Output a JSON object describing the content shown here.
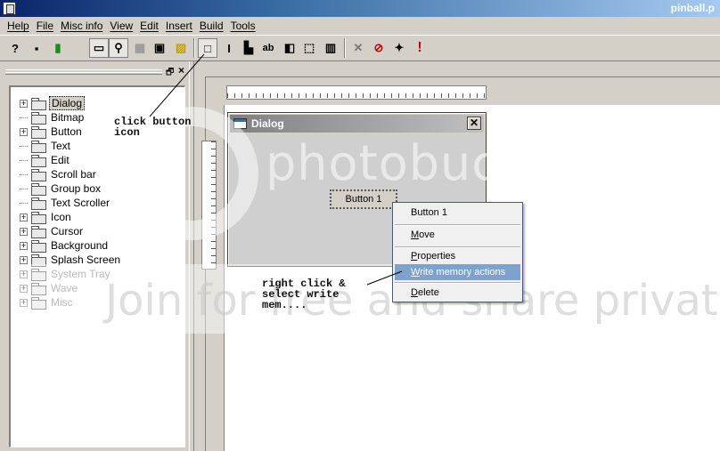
{
  "window": {
    "title": "pinball.p"
  },
  "menubar": {
    "items": [
      "Help",
      "File",
      "Misc info",
      "View",
      "Edit",
      "Insert",
      "Build",
      "Tools"
    ]
  },
  "toolbar": {
    "buttons": [
      {
        "icon": "help-icon",
        "glyph": "?"
      },
      {
        "icon": "save-icon",
        "glyph": "▪"
      },
      {
        "icon": "chart-icon",
        "glyph": "▮"
      },
      {
        "icon": "blank-icon",
        "glyph": ""
      },
      {
        "icon": "window-icon",
        "glyph": "▭"
      },
      {
        "icon": "magnifier-icon",
        "glyph": "⚲"
      },
      {
        "icon": "grid-icon",
        "glyph": "▦"
      },
      {
        "icon": "screen-icon",
        "glyph": "▣"
      },
      {
        "icon": "paint-icon",
        "glyph": "▨"
      },
      {
        "icon": "button-control-icon",
        "glyph": "□"
      },
      {
        "icon": "text-cursor-icon",
        "glyph": "I"
      },
      {
        "icon": "image-control-icon",
        "glyph": "▙"
      },
      {
        "icon": "edit-control-icon",
        "glyph": "ab"
      },
      {
        "icon": "scrollbar-control-icon",
        "glyph": "◧"
      },
      {
        "icon": "groupbox-control-icon",
        "glyph": "⬚"
      },
      {
        "icon": "film-icon",
        "glyph": "▥"
      },
      {
        "icon": "delete-x-icon",
        "glyph": "✕"
      },
      {
        "icon": "stop-icon",
        "glyph": "⊘"
      },
      {
        "icon": "tools-icon",
        "glyph": "✦"
      },
      {
        "icon": "alert-icon",
        "glyph": "!"
      }
    ]
  },
  "tree": {
    "items": [
      {
        "label": "Dialog",
        "expandable": true,
        "selected": true,
        "dim": false
      },
      {
        "label": "Bitmap",
        "expandable": false,
        "selected": false,
        "dim": false
      },
      {
        "label": "Button",
        "expandable": true,
        "selected": false,
        "dim": false
      },
      {
        "label": "Text",
        "expandable": false,
        "selected": false,
        "dim": false
      },
      {
        "label": "Edit",
        "expandable": false,
        "selected": false,
        "dim": false
      },
      {
        "label": "Scroll bar",
        "expandable": false,
        "selected": false,
        "dim": false
      },
      {
        "label": "Group box",
        "expandable": false,
        "selected": false,
        "dim": false
      },
      {
        "label": "Text Scroller",
        "expandable": false,
        "selected": false,
        "dim": false
      },
      {
        "label": "Icon",
        "expandable": true,
        "selected": false,
        "dim": false
      },
      {
        "label": "Cursor",
        "expandable": true,
        "selected": false,
        "dim": false
      },
      {
        "label": "Background",
        "expandable": true,
        "selected": false,
        "dim": false
      },
      {
        "label": "Splash Screen",
        "expandable": true,
        "selected": false,
        "dim": false
      },
      {
        "label": "System Tray",
        "expandable": true,
        "selected": false,
        "dim": true
      },
      {
        "label": "Wave",
        "expandable": true,
        "selected": false,
        "dim": true
      },
      {
        "label": "Misc",
        "expandable": true,
        "selected": false,
        "dim": true
      }
    ]
  },
  "dialog": {
    "title": "Dialog",
    "close_glyph": "✕",
    "button_label": "Button 1"
  },
  "context_menu": {
    "header": "Button 1",
    "items": [
      {
        "label": "Move",
        "underline": "M",
        "highlighted": false
      },
      {
        "label": "Properties",
        "underline": "P",
        "highlighted": false
      },
      {
        "label": "Write memory actions",
        "underline": "W",
        "highlighted": true
      },
      {
        "label": "Delete",
        "underline": "D",
        "highlighted": false
      }
    ]
  },
  "annotations": {
    "top": "click button\nicon",
    "bottom": "right click &\nselect write\nmem...."
  },
  "watermark": {
    "logo": "photobucket",
    "tagline": "Join for free and share privately."
  },
  "colors": {
    "title_bar": "#0a246a",
    "menu_highlight": "#7da2ce",
    "chrome": "#d4d0c8"
  }
}
